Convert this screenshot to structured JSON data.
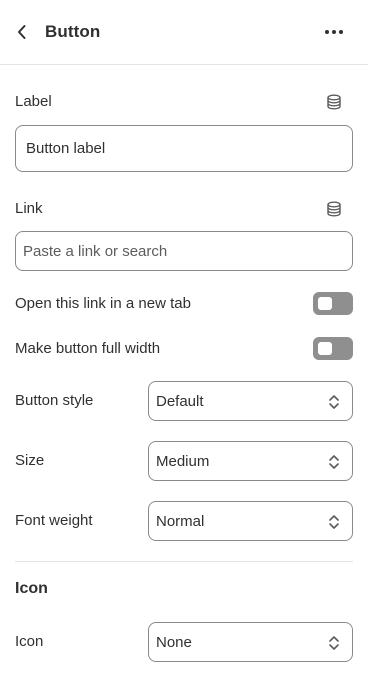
{
  "header": {
    "title": "Button",
    "back_icon": "chevron-left-icon",
    "more_icon": "more-horizontal-icon"
  },
  "label_field": {
    "label": "Label",
    "value": "Button label",
    "source_icon": "database-icon"
  },
  "link_field": {
    "label": "Link",
    "placeholder": "Paste a link or search",
    "source_icon": "database-icon"
  },
  "toggles": [
    {
      "label": "Open this link in a new tab",
      "on": false
    },
    {
      "label": "Make button full width",
      "on": false
    }
  ],
  "selects": [
    {
      "label": "Button style",
      "value": "Default"
    },
    {
      "label": "Size",
      "value": "Medium"
    },
    {
      "label": "Font weight",
      "value": "Normal"
    }
  ],
  "icon_section": {
    "title": "Icon",
    "select": {
      "label": "Icon",
      "value": "None"
    }
  },
  "colors": {
    "text": "#303030",
    "border": "#8a8a8a",
    "toggle_off": "#8f8f8f",
    "divider": "#e3e3e3"
  }
}
